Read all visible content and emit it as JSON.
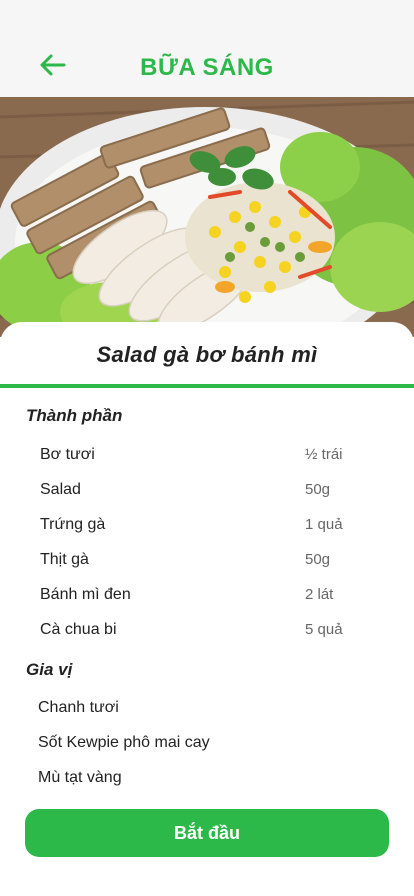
{
  "header": {
    "title": "BỮA SÁNG",
    "back_icon": "arrow-left-icon",
    "accent_color": "#2db84a"
  },
  "dish": {
    "name": "Salad gà bơ bánh mì",
    "image_icon": "salad-photo"
  },
  "ingredients": {
    "title": "Thành phần",
    "items": [
      {
        "name": "Bơ tươi",
        "qty": "½ trái"
      },
      {
        "name": "Salad",
        "qty": "50g"
      },
      {
        "name": "Trứng gà",
        "qty": "1 quả"
      },
      {
        "name": "Thịt gà",
        "qty": "50g"
      },
      {
        "name": "Bánh mì đen",
        "qty": "2 lát"
      },
      {
        "name": "Cà chua bi",
        "qty": "5 quả"
      }
    ]
  },
  "spices": {
    "title": "Gia vị",
    "items": [
      "Chanh tươi",
      "Sốt Kewpie phô mai cay",
      "Mù tạt vàng"
    ]
  },
  "actions": {
    "start_label": "Bắt đầu"
  }
}
